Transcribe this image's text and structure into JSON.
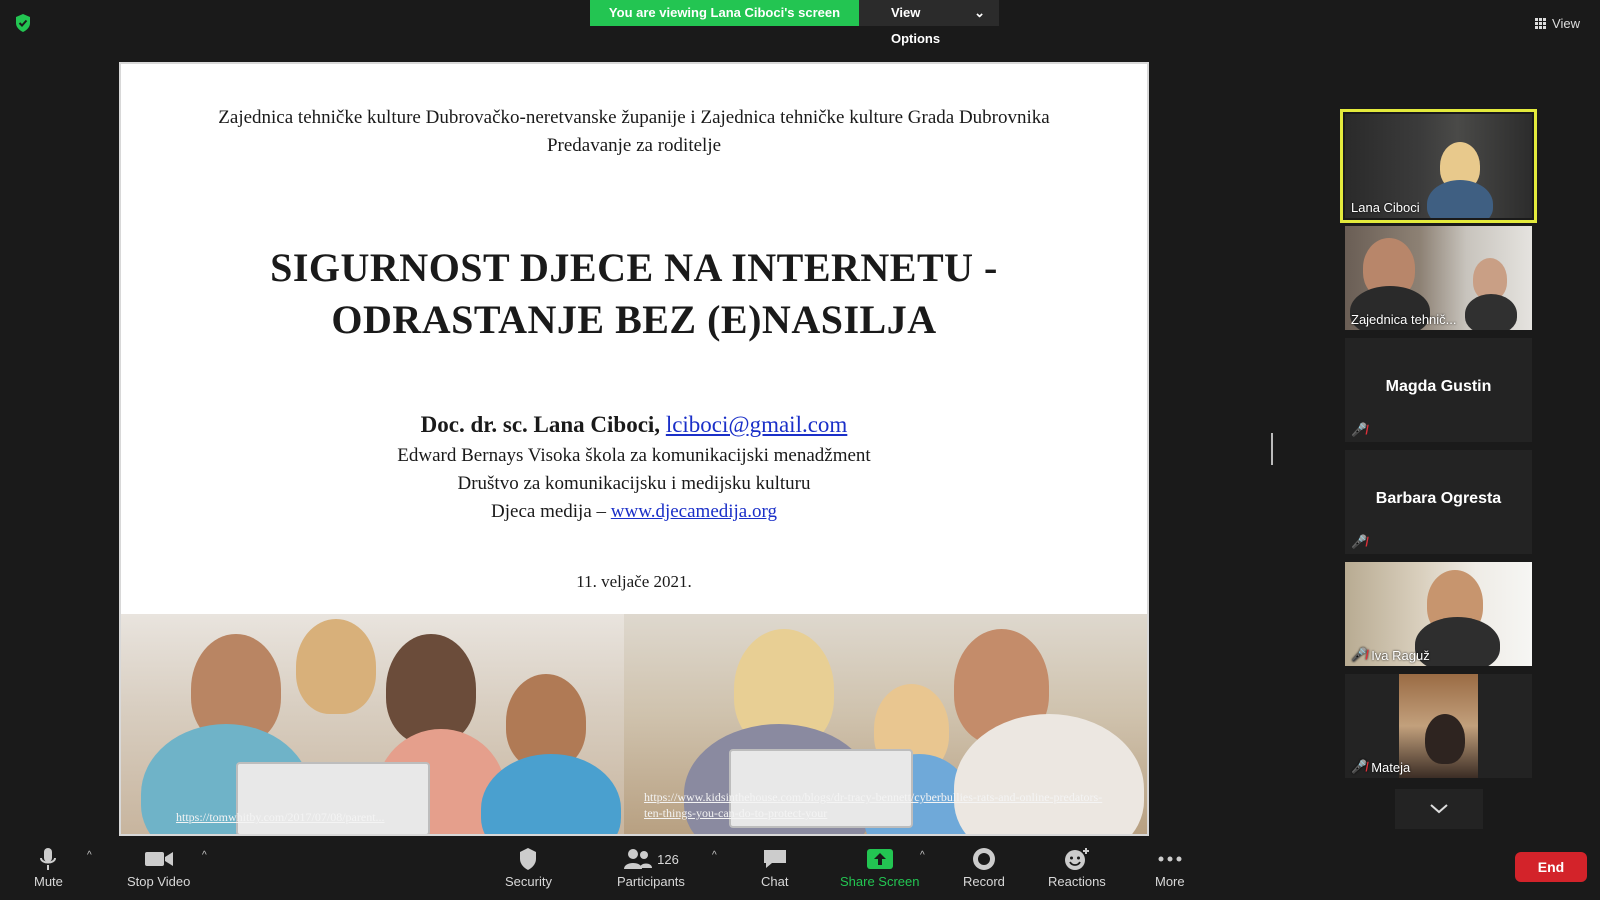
{
  "top": {
    "banner": "You are viewing Lana Ciboci's screen",
    "view_options": "View Options",
    "view": "View"
  },
  "slide": {
    "org_line1": "Zajednica tehničke kulture Dubrovačko-neretvanske županije i Zajednica tehničke kulture Grada Dubrovnika",
    "org_line2": "Predavanje za roditelje",
    "title_line1": "SIGURNOST DJECE NA INTERNETU -",
    "title_line2": "ODRASTANJE BEZ (E)NASILJA",
    "author": "Doc. dr. sc. Lana Ciboci,",
    "author_email": "lciboci@gmail.com",
    "affiliation1": "Edward Bernays Visoka škola za komunikacijski menadžment",
    "affiliation2": "Društvo za komunikacijsku i medijsku kulturu",
    "affiliation3_prefix": "Djeca medija –",
    "affiliation3_link": "www.djecamedija.org",
    "date": "11. veljače 2021.",
    "photo_left_url": "https://tomwhitby.com/2017/07/08/parent...",
    "photo_right_url": "https://www.kidsinthehouse.com/blogs/dr-tracy-bennett/cyberbullies-rats-and-online-predators-ten-things-you-can-do-to-protect-your"
  },
  "participants": [
    {
      "name": "Lana Ciboci",
      "video": true,
      "active": true,
      "muted": false
    },
    {
      "name": "Zajednica tehnič...",
      "video": true,
      "active": false,
      "muted": false
    },
    {
      "name": "Magda Gustin",
      "video": false,
      "active": false,
      "muted": true
    },
    {
      "name": "Barbara Ogresta",
      "video": false,
      "active": false,
      "muted": true
    },
    {
      "name": "Iva Raguž",
      "video": true,
      "active": false,
      "muted": true
    },
    {
      "name": "Mateja",
      "video": true,
      "active": false,
      "muted": true
    }
  ],
  "toolbar": {
    "mute": "Mute",
    "stop_video": "Stop Video",
    "security": "Security",
    "participants": "Participants",
    "participants_count": "126",
    "chat": "Chat",
    "share_screen": "Share Screen",
    "record": "Record",
    "reactions": "Reactions",
    "more": "More",
    "end": "End"
  },
  "colors": {
    "banner_green": "#23c552",
    "active_speaker": "#e3ea3c",
    "end_red": "#d3232a",
    "muted_red": "#e0303a",
    "link_blue": "#1a2fc8"
  }
}
